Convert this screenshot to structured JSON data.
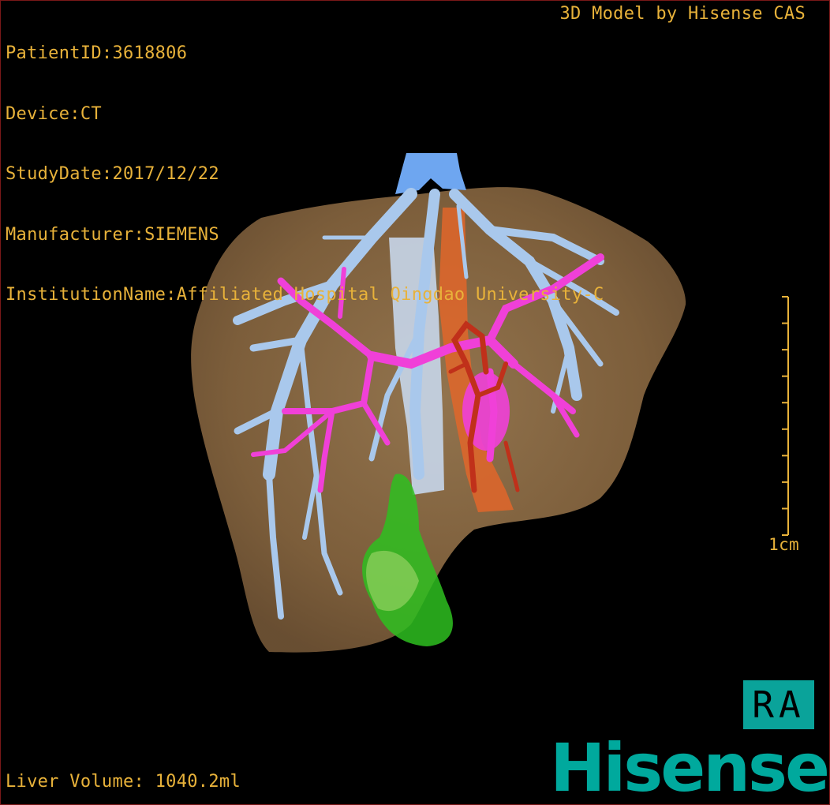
{
  "study_info": [
    "PatientID:3618806",
    "Device:CT",
    "StudyDate:2017/12/22",
    "Manufacturer:SIEMENS",
    "InstitutionName:Affiliated Hospital Qingdao University-C"
  ],
  "header": {
    "credit": "3D Model by Hisense CAS"
  },
  "scale_bar": {
    "label": "1cm",
    "tick_count": 10
  },
  "footer": {
    "volume": "Liver Volume: 1040.2ml"
  },
  "orientation": {
    "label": "RA"
  },
  "brand": {
    "logo_text": "Hisense"
  },
  "colors": {
    "overlay_text": "#e8b23a",
    "liver": "#8a6a45",
    "hepatic_vein": "#a9c8ec",
    "inferior_vena_cava": "#6ea6f0",
    "portal_vein": "#f040d8",
    "hepatic_artery": "#c0301a",
    "aorta": "#e0662a",
    "gallbladder": "#2ec020",
    "orientation_badge": "#0aa39a",
    "brand": "#00a99d"
  }
}
